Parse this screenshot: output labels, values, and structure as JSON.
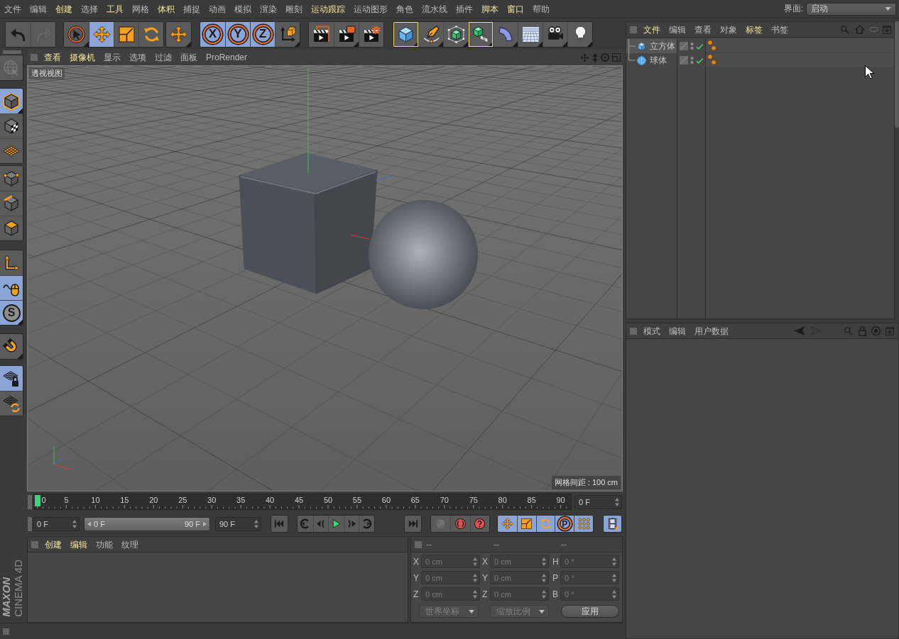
{
  "menu_bar": {
    "items": [
      {
        "label": "文件",
        "highlighted": false
      },
      {
        "label": "编辑",
        "highlighted": false
      },
      {
        "label": "创建",
        "highlighted": true
      },
      {
        "label": "选择",
        "highlighted": false
      },
      {
        "label": "工具",
        "highlighted": true
      },
      {
        "label": "网格",
        "highlighted": false
      },
      {
        "label": "体积",
        "highlighted": true
      },
      {
        "label": "捕捉",
        "highlighted": false
      },
      {
        "label": "动画",
        "highlighted": false
      },
      {
        "label": "模拟",
        "highlighted": false
      },
      {
        "label": "渲染",
        "highlighted": false
      },
      {
        "label": "雕刻",
        "highlighted": false
      },
      {
        "label": "运动跟踪",
        "highlighted": true
      },
      {
        "label": "运动图形",
        "highlighted": false
      },
      {
        "label": "角色",
        "highlighted": false
      },
      {
        "label": "流水线",
        "highlighted": false
      },
      {
        "label": "插件",
        "highlighted": false
      },
      {
        "label": "脚本",
        "highlighted": true
      },
      {
        "label": "窗口",
        "highlighted": true
      },
      {
        "label": "帮助",
        "highlighted": false
      }
    ],
    "layout_label": "界面:",
    "layout_value": "启动"
  },
  "toolbar": {
    "groups": [
      {
        "buttons": [
          {
            "selected": false,
            "outlined": false,
            "disabled": false
          },
          {
            "selected": false,
            "outlined": false,
            "disabled": true
          }
        ]
      },
      {
        "buttons": [
          {
            "selected": false,
            "outlined": false,
            "disabled": false
          },
          {
            "selected": true,
            "outlined": false,
            "disabled": false
          },
          {
            "selected": false,
            "outlined": false,
            "disabled": false
          },
          {
            "selected": false,
            "outlined": false,
            "disabled": false
          }
        ]
      },
      {
        "buttons": [
          {
            "selected": false,
            "outlined": false,
            "disabled": false
          }
        ]
      },
      {
        "buttons": [
          {
            "label": "X",
            "selected": true,
            "outlined": false,
            "disabled": false
          },
          {
            "label": "Y",
            "selected": true,
            "outlined": false,
            "disabled": false
          },
          {
            "label": "Z",
            "selected": true,
            "outlined": false,
            "disabled": false
          },
          {
            "selected": false,
            "outlined": false,
            "disabled": false
          }
        ]
      },
      {
        "buttons": [
          {
            "selected": false,
            "outlined": false,
            "disabled": false
          },
          {
            "selected": false,
            "outlined": false,
            "disabled": false
          },
          {
            "selected": false,
            "outlined": false,
            "disabled": false
          }
        ]
      },
      {
        "buttons": [
          {
            "selected": false,
            "outlined": true,
            "disabled": false
          },
          {
            "selected": false,
            "outlined": false,
            "disabled": false
          },
          {
            "selected": false,
            "outlined": false,
            "disabled": false
          },
          {
            "selected": false,
            "outlined": true,
            "disabled": false
          },
          {
            "selected": false,
            "outlined": false,
            "disabled": false
          },
          {
            "selected": false,
            "outlined": false,
            "disabled": false
          },
          {
            "selected": false,
            "outlined": false,
            "disabled": false
          },
          {
            "selected": false,
            "outlined": false,
            "disabled": false
          }
        ]
      }
    ]
  },
  "tool_palette": {
    "groups": [
      {
        "buttons": [
          {
            "selected": false,
            "disabled": true
          }
        ]
      },
      {
        "buttons": [
          {
            "selected": true,
            "disabled": false
          },
          {
            "selected": false,
            "disabled": false
          },
          {
            "selected": false,
            "disabled": false
          }
        ]
      },
      {
        "buttons": [
          {
            "selected": false,
            "disabled": false
          },
          {
            "selected": false,
            "disabled": false
          },
          {
            "selected": false,
            "disabled": false
          }
        ]
      },
      {
        "buttons": [
          {
            "selected": false,
            "disabled": false
          },
          {
            "selected": true,
            "disabled": false
          },
          {
            "label": "S",
            "selected": true,
            "disabled": false
          }
        ]
      },
      {
        "buttons": [
          {
            "selected": false,
            "disabled": false
          }
        ]
      },
      {
        "buttons": [
          {
            "selected": true,
            "disabled": false
          },
          {
            "selected": false,
            "disabled": false
          }
        ]
      }
    ]
  },
  "viewport": {
    "menu": [
      {
        "label": "查看",
        "highlighted": true
      },
      {
        "label": "摄像机",
        "highlighted": true
      },
      {
        "label": "显示",
        "highlighted": false
      },
      {
        "label": "选项",
        "highlighted": false
      },
      {
        "label": "过滤",
        "highlighted": false
      },
      {
        "label": "面板",
        "highlighted": false
      },
      {
        "label": "ProRender",
        "highlighted": false
      }
    ],
    "view_name": "透视视图",
    "grid_spacing": "网格间距 : 100 cm"
  },
  "timeline": {
    "frame_labels": [
      "0",
      "5",
      "10",
      "15",
      "20",
      "25",
      "30",
      "35",
      "40",
      "45",
      "50",
      "55",
      "60",
      "65",
      "70",
      "75",
      "80",
      "85",
      "90"
    ],
    "playhead": {
      "level": 0
    },
    "current_frame": "0 F"
  },
  "transport": {
    "start_frame": "0 F",
    "range": {
      "start": "0 F",
      "end": "90 F",
      "level": 1
    },
    "end_frame": "90 F",
    "groups": [
      {
        "buttons": [
          {
            "selected": false,
            "disabled": false
          }
        ]
      },
      {
        "buttons": [
          {
            "selected": false,
            "disabled": false
          },
          {
            "selected": false,
            "disabled": false
          },
          {
            "selected": false,
            "disabled": false
          },
          {
            "selected": false,
            "disabled": false
          },
          {
            "selected": false,
            "disabled": false
          }
        ]
      },
      {
        "buttons": [
          {
            "selected": false,
            "disabled": false
          }
        ]
      },
      {
        "buttons": [
          {
            "selected": false,
            "disabled": true
          },
          {
            "selected": false,
            "disabled": false
          },
          {
            "selected": false,
            "disabled": false
          }
        ]
      },
      {
        "buttons": [
          {
            "selected": true,
            "disabled": false
          },
          {
            "selected": true,
            "disabled": false
          },
          {
            "selected": true,
            "disabled": false
          },
          {
            "label": "P",
            "selected": true,
            "disabled": false
          },
          {
            "selected": true,
            "disabled": false
          }
        ]
      },
      {
        "buttons": [
          {
            "selected": true,
            "disabled": false
          }
        ]
      }
    ]
  },
  "material_manager": {
    "menu": [
      {
        "label": "创建",
        "highlighted": true
      },
      {
        "label": "编辑",
        "highlighted": true
      },
      {
        "label": "功能",
        "highlighted": false
      },
      {
        "label": "纹理",
        "highlighted": false
      }
    ]
  },
  "coordinates": {
    "columns": [
      "--",
      "--",
      "--"
    ],
    "disabled": true,
    "rows": [
      {
        "cells": [
          {
            "axis": "X",
            "value": "0 cm"
          },
          {
            "axis": "X",
            "value": "0 cm"
          },
          {
            "axis": "H",
            "value": "0 °"
          }
        ]
      },
      {
        "cells": [
          {
            "axis": "Y",
            "value": "0 cm"
          },
          {
            "axis": "Y",
            "value": "0 cm"
          },
          {
            "axis": "P",
            "value": "0 °"
          }
        ]
      },
      {
        "cells": [
          {
            "axis": "Z",
            "value": "0 cm"
          },
          {
            "axis": "Z",
            "value": "0 cm"
          },
          {
            "axis": "B",
            "value": "0 °"
          }
        ]
      }
    ],
    "dropdowns": [
      {
        "value": "世界坐标"
      },
      {
        "value": "缩放比例"
      }
    ],
    "apply_button": "应用"
  },
  "logo": {
    "brand": "MAXON",
    "product": "CINEMA 4D"
  },
  "object_manager": {
    "menu": [
      {
        "label": "文件",
        "highlighted": true
      },
      {
        "label": "编辑",
        "highlighted": false
      },
      {
        "label": "查看",
        "highlighted": false
      },
      {
        "label": "对象",
        "highlighted": false
      },
      {
        "label": "标签",
        "highlighted": true
      },
      {
        "label": "书签",
        "highlighted": false
      }
    ],
    "objects": [
      {
        "name": "立方体",
        "selected": true,
        "enabled": true
      },
      {
        "name": "球体",
        "selected": false,
        "enabled": true
      }
    ]
  },
  "attribute_manager": {
    "menu": [
      "模式",
      "编辑",
      "用户数据"
    ]
  }
}
